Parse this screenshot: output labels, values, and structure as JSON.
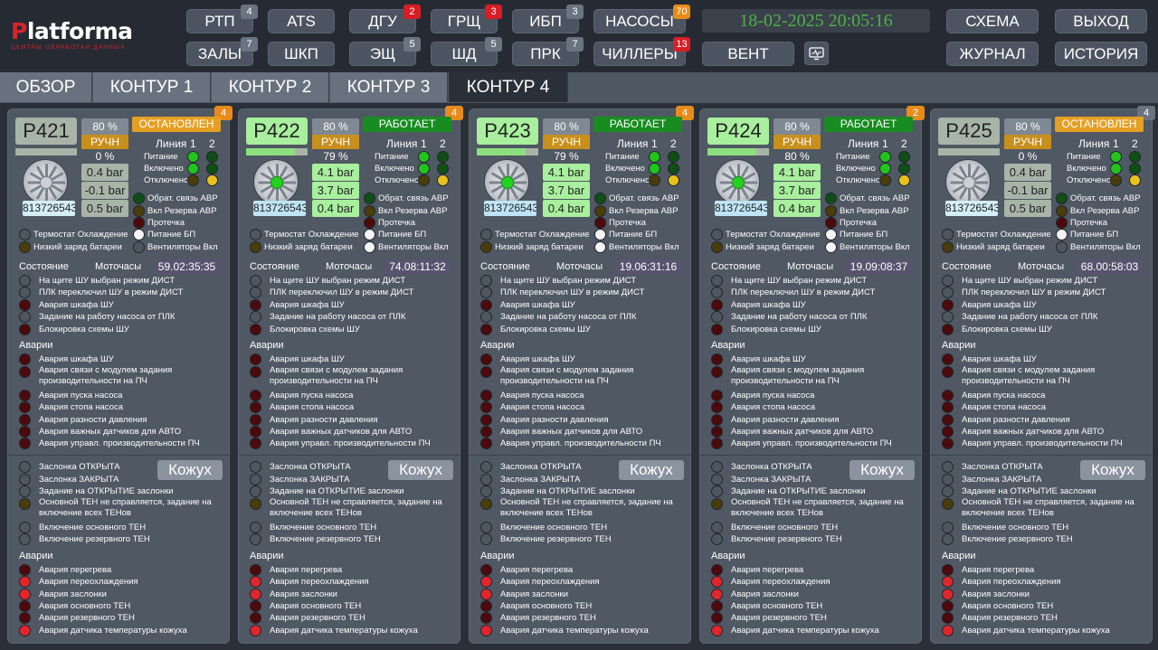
{
  "brand": {
    "name_pre": "P",
    "name_rest": "latforma",
    "subtitle": "ЦЕНТРЫ ОБРАБОТКИ ДАННЫХ"
  },
  "nav": {
    "rtp": {
      "label": "РТП",
      "badge": "4"
    },
    "ats": {
      "label": "ATS"
    },
    "dgu": {
      "label": "ДГУ",
      "badge": "2"
    },
    "grsch": {
      "label": "ГРЩ",
      "badge": "3"
    },
    "ibp": {
      "label": "ИБП",
      "badge": "3"
    },
    "nasosy": {
      "label": "НАСОСЫ",
      "badge": "70"
    },
    "zaly": {
      "label": "ЗАЛЫ",
      "badge": "7"
    },
    "shkp": {
      "label": "ШКП"
    },
    "esch": {
      "label": "ЭЩ",
      "badge": "5"
    },
    "shd": {
      "label": "ШД",
      "badge": "5"
    },
    "prk": {
      "label": "ПРК",
      "badge": "7"
    },
    "chillery": {
      "label": "ЧИЛЛЕРЫ",
      "badge": "13"
    },
    "vent": {
      "label": "ВЕНТ"
    },
    "schema": {
      "label": "СХЕМА"
    },
    "exit": {
      "label": "ВЫХОД"
    },
    "journal": {
      "label": "ЖУРНАЛ"
    },
    "history": {
      "label": "ИСТОРИЯ"
    }
  },
  "clock": "18-02-2025 20:05:16",
  "tabs": [
    "ОБЗОР",
    "КОНТУР 1",
    "КОНТУР 2",
    "КОНТУР 3",
    "КОНТУР 4"
  ],
  "active_tab": "КОНТУР 4",
  "colors": {
    "led_green": "#22c41c",
    "led_dark_green": "#0f4f16",
    "led_yellow": "#e8c21a",
    "led_dark_yellow": "#4a3d0c",
    "led_dark_red": "#4d0a0c",
    "led_red": "#e0262c",
    "led_off": "#4e5660",
    "led_white": "#f4f4f4"
  },
  "labels": {
    "line": "Линия",
    "l1": "1",
    "l2": "2",
    "pitanie": "Питание",
    "vklyucheno": "Включено",
    "otklyucheno": "Отключено",
    "avr_feedback": "Обрат. связь АВР",
    "avr_reserve": "Вкл Резерва АВР",
    "leak": "Протечка",
    "thermostat": "Термостат Охлаждение",
    "psu_power": "Питание БП",
    "low_battery": "Низкий заряд батареи",
    "fans_on": "Вентиляторы Вкл",
    "state_title": "Состояние",
    "motohours": "Моточасы",
    "state_rows": [
      "На щите ШУ выбран режим ДИСТ",
      "ПЛК переключил ШУ в режим ДИСТ",
      "Авария шкафа ШУ",
      "Задание на работу насоса от ПЛК",
      "Блокировка схемы ШУ"
    ],
    "alarms_title": "Аварии",
    "alarm_rows": [
      "Авария шкафа ШУ",
      "Авария связи с модулем задания производительности на ПЧ",
      "Авария пуска насоса",
      "Авария стопа насоса",
      "Авария разности давления",
      "Авария важных датчиков для АВТО",
      "Авария управл. производительности ПЧ"
    ],
    "casing": "Кожух",
    "casing_rows": [
      "Заслонка ОТКРЫТА",
      "Заслонка ЗАКРЫТА",
      "Задание на ОТКРЫТИЕ заслонки",
      "Основной ТЕН не справляется, задание на включение всех ТЕНов",
      "Включение основного ТЕН",
      "Включение резервного ТЕН"
    ],
    "casing_alarms_title": "Аварии",
    "casing_alarm_rows": [
      "Авария перегрева",
      "Авария переохлаждения",
      "Авария заслонки",
      "Авария основного ТЕН",
      "Авария резервного ТЕН",
      "Авария датчика температуры кожуха"
    ]
  },
  "pumps": [
    {
      "name": "P421",
      "badge": "4",
      "badge_color": "orange",
      "running": false,
      "speed_set": "80 %",
      "mode": "РУЧН",
      "speed_act": "0 %",
      "speed_fraction": 0,
      "state": "ОСТАНОВЛЕН",
      "serial": "813726543",
      "p1": "0.4 bar",
      "p2": "-0.1 bar",
      "p3": "0.5 bar",
      "hours": "59.02:35:35"
    },
    {
      "name": "P422",
      "badge": "4",
      "badge_color": "orange",
      "running": true,
      "speed_set": "80 %",
      "mode": "РУЧН",
      "speed_act": "79 %",
      "speed_fraction": 0.79,
      "state": "РАБОТАЕТ",
      "serial": "813726543",
      "p1": "4.1 bar",
      "p2": "3.7 bar",
      "p3": "0.4 bar",
      "hours": "74.08:11:32"
    },
    {
      "name": "P423",
      "badge": "4",
      "badge_color": "orange",
      "running": true,
      "speed_set": "80 %",
      "mode": "РУЧН",
      "speed_act": "79 %",
      "speed_fraction": 0.79,
      "state": "РАБОТАЕТ",
      "serial": "813726543",
      "p1": "4.1 bar",
      "p2": "3.7 bar",
      "p3": "0.4 bar",
      "hours": "19.06:31:16"
    },
    {
      "name": "P424",
      "badge": "2",
      "badge_color": "orange",
      "running": true,
      "speed_set": "80 %",
      "mode": "РУЧН",
      "speed_act": "80 %",
      "speed_fraction": 0.8,
      "state": "РАБОТАЕТ",
      "serial": "813726543",
      "p1": "4.1 bar",
      "p2": "3.7 bar",
      "p3": "0.4 bar",
      "hours": "19.09:08:37"
    },
    {
      "name": "P425",
      "badge": "4",
      "badge_color": "grey",
      "running": false,
      "speed_set": "80 %",
      "mode": "РУЧН",
      "speed_act": "0 %",
      "speed_fraction": 0,
      "state": "ОСТАНОВЛЕН",
      "serial": "813726543",
      "p1": "0.4 bar",
      "p2": "-0.1 bar",
      "p3": "0.5 bar",
      "hours": "68.00:58:03"
    }
  ]
}
